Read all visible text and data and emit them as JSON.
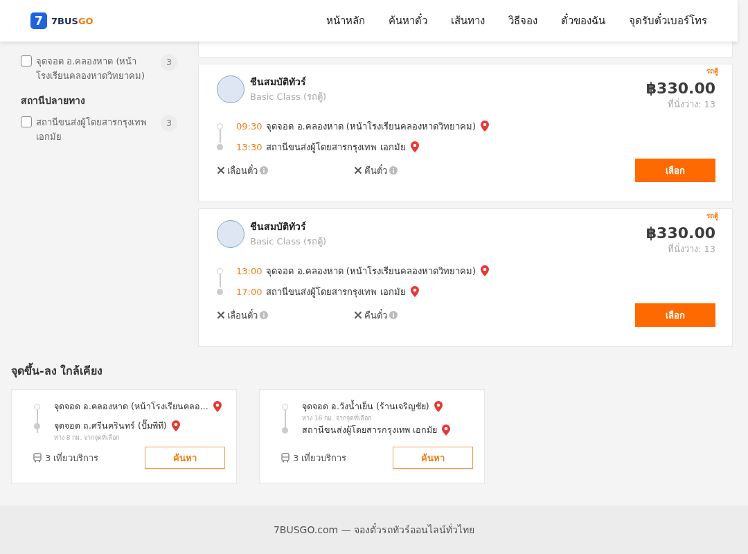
{
  "header": {
    "logo": {
      "mark": "7",
      "text_main": "7BUS",
      "text_accent": "GO"
    },
    "nav": [
      "หน้าหลัก",
      "ค้นหาตั๋ว",
      "เส้นทาง",
      "วิธีจอง",
      "ตั๋วของฉัน",
      "จุดรับตั๋วเบอร์โทร"
    ]
  },
  "sidebar": {
    "sections": [
      {
        "options": [
          {
            "label": "จุดจอด อ.คลองหาด (หน้าโรงเรียนคลองหาดวิทยาคม)",
            "count": "3",
            "checked": false
          }
        ]
      },
      {
        "title": "สถานีปลายทาง",
        "options": [
          {
            "label": "สถานีขนส่งผู้โดยสารกรุงเทพ เอกมัย",
            "count": "3",
            "checked": false
          }
        ]
      }
    ]
  },
  "trips": [
    {
      "badge": "รถตู้",
      "operator": "ชีนสมบัติทัวร์",
      "class": "Basic Class (รถตู้)",
      "price": "฿330.00",
      "seats": "ที่นั่งว่าง: 13",
      "stops": [
        {
          "time": "09:30",
          "place": "จุดจอด อ.คลองหาด (หน้าโรงเรียนคลองหาดวิทยาคม)"
        },
        {
          "time": "13:30",
          "place": "สถานีขนส่งผู้โดยสารกรุงเทพ เอกมัย"
        }
      ],
      "policies": [
        {
          "label": "เลื่อนตั๋ว",
          "allowed": false
        },
        {
          "label": "คืนตั๋ว",
          "allowed": false
        }
      ],
      "button": "เลือก"
    },
    {
      "badge": "รถตู้",
      "operator": "ชีนสมบัติทัวร์",
      "class": "Basic Class (รถตู้)",
      "price": "฿330.00",
      "seats": "ที่นั่งว่าง: 13",
      "stops": [
        {
          "time": "13:00",
          "place": "จุดจอด อ.คลองหาด (หน้าโรงเรียนคลองหาดวิทยาคม)"
        },
        {
          "time": "17:00",
          "place": "สถานีขนส่งผู้โดยสารกรุงเทพ เอกมัย"
        }
      ],
      "policies": [
        {
          "label": "เลื่อนตั๋ว",
          "allowed": false
        },
        {
          "label": "คืนตั๋ว",
          "allowed": false
        }
      ],
      "button": "เลือก"
    }
  ],
  "nearby": {
    "title": "จุดขึ้น-ลง ใกล้เคียง",
    "cards": [
      {
        "stops": [
          {
            "place": "จุดจอด อ.คลองหาด (หน้าโรงเรียนคลอ..."
          },
          {
            "place": "จุดจอด ถ.ศรีนครินทร์ (ปั๊มพีที)",
            "note": "ห่าง 8 กม. จากจุดที่เลือก"
          }
        ],
        "trips": "3 เที่ยวบริการ",
        "button": "ค้นหา"
      },
      {
        "stops": [
          {
            "place": "จุดจอด อ.วังน้ำเย็น (ร้านเจริญชัย)",
            "note": "ห่าง 16 กม. จากจุดที่เลือก"
          },
          {
            "place": "สถานีขนส่งผู้โดยสารกรุงเทพ เอกมัย"
          }
        ],
        "trips": "3 เที่ยวบริการ",
        "button": "ค้นหา"
      }
    ]
  },
  "footer": {
    "text": "7BUSGO.com — จองตั๋วรถทัวร์ออนไลน์ทั่วไทย"
  }
}
